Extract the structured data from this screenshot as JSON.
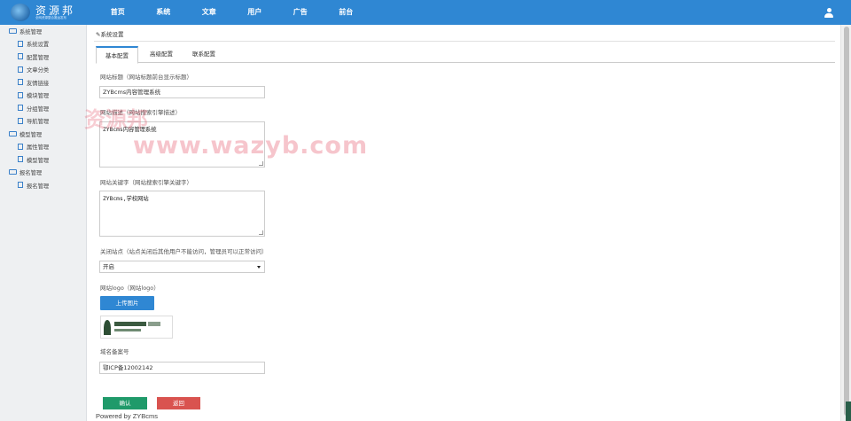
{
  "brand": {
    "title": "资源邦",
    "subtitle": "全网资源整合搬运发布"
  },
  "nav": [
    "首页",
    "系统",
    "文章",
    "用户",
    "广告",
    "前台"
  ],
  "sidebar": {
    "groups": [
      {
        "label": "系统管理",
        "items": [
          "系统设置",
          "配置管理",
          "文章分类",
          "友情链接",
          "模块管理",
          "分组管理",
          "导航管理"
        ]
      },
      {
        "label": "模型管理",
        "items": [
          "属性管理",
          "模型管理"
        ]
      },
      {
        "label": "报名管理",
        "items": [
          "报名管理"
        ]
      }
    ]
  },
  "breadcrumb": "系统设置",
  "tabs": [
    "基本配置",
    "高级配置",
    "联系配置"
  ],
  "form": {
    "site_title": {
      "label": "网站标题（网站标题前台显示标题）",
      "value": "ZYBcms内容管理系统"
    },
    "site_desc": {
      "label": "网站描述（网站搜索引擎描述）",
      "value": "ZYBcms内容管理系统"
    },
    "site_keywords": {
      "label": "网站关键字（网站搜索引擎关键字）",
      "value": "ZYBcms,学校网站"
    },
    "site_close": {
      "label": "关闭站点（站点关闭后其他用户不能访问，管理员可以正常访问）",
      "value": "开启"
    },
    "site_logo": {
      "label": "网站logo（网站logo）",
      "upload_label": "上传图片"
    },
    "icp": {
      "label": "域名备案号",
      "value": "鄂ICP备12002142"
    }
  },
  "buttons": {
    "ok": "确认",
    "back": "返回"
  },
  "footer": "Powered by ZYBcms",
  "watermark": {
    "cn": "资源邦",
    "url": "www.wazyb.com"
  },
  "colors": {
    "topbar": "#2f87d3",
    "ok": "#1f9a6a",
    "back": "#d9534f"
  }
}
